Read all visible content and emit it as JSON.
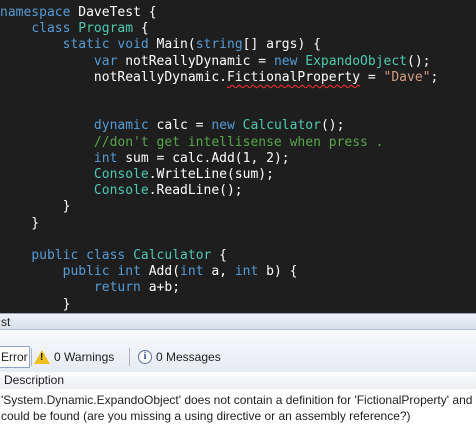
{
  "editor": {
    "lines": [
      {
        "segments": [
          {
            "t": "namespace",
            "c": "kw"
          },
          {
            "t": " DaveTest {",
            "c": ""
          }
        ]
      },
      {
        "segments": [
          {
            "t": "    ",
            "c": ""
          },
          {
            "t": "class",
            "c": "kw"
          },
          {
            "t": " ",
            "c": ""
          },
          {
            "t": "Program",
            "c": "ty"
          },
          {
            "t": " {",
            "c": ""
          }
        ]
      },
      {
        "segments": [
          {
            "t": "        ",
            "c": ""
          },
          {
            "t": "static",
            "c": "kw"
          },
          {
            "t": " ",
            "c": ""
          },
          {
            "t": "void",
            "c": "kw"
          },
          {
            "t": " Main(",
            "c": ""
          },
          {
            "t": "string",
            "c": "kw"
          },
          {
            "t": "[] args) {",
            "c": ""
          }
        ]
      },
      {
        "segments": [
          {
            "t": "            ",
            "c": ""
          },
          {
            "t": "var",
            "c": "kw"
          },
          {
            "t": " notReallyDynamic = ",
            "c": ""
          },
          {
            "t": "new",
            "c": "kw"
          },
          {
            "t": " ",
            "c": ""
          },
          {
            "t": "ExpandoObject",
            "c": "ty"
          },
          {
            "t": "();",
            "c": ""
          }
        ]
      },
      {
        "segments": [
          {
            "t": "            notReallyDynamic.",
            "c": ""
          },
          {
            "t": "FictionalProperty",
            "c": "squiggle"
          },
          {
            "t": " = ",
            "c": ""
          },
          {
            "t": "\"Dave\"",
            "c": "st"
          },
          {
            "t": ";",
            "c": ""
          }
        ]
      },
      {
        "segments": []
      },
      {
        "segments": []
      },
      {
        "segments": [
          {
            "t": "            ",
            "c": ""
          },
          {
            "t": "dynamic",
            "c": "kw"
          },
          {
            "t": " calc = ",
            "c": ""
          },
          {
            "t": "new",
            "c": "kw"
          },
          {
            "t": " ",
            "c": ""
          },
          {
            "t": "Calculator",
            "c": "ty"
          },
          {
            "t": "();",
            "c": ""
          }
        ]
      },
      {
        "segments": [
          {
            "t": "            ",
            "c": ""
          },
          {
            "t": "//don't get intellisense when press .",
            "c": "cm"
          }
        ]
      },
      {
        "segments": [
          {
            "t": "            ",
            "c": ""
          },
          {
            "t": "int",
            "c": "kw"
          },
          {
            "t": " sum = calc.Add(1, 2);",
            "c": ""
          }
        ]
      },
      {
        "segments": [
          {
            "t": "            ",
            "c": ""
          },
          {
            "t": "Console",
            "c": "ty"
          },
          {
            "t": ".WriteLine(sum);",
            "c": ""
          }
        ]
      },
      {
        "segments": [
          {
            "t": "            ",
            "c": ""
          },
          {
            "t": "Console",
            "c": "ty"
          },
          {
            "t": ".ReadLine();",
            "c": ""
          }
        ]
      },
      {
        "segments": [
          {
            "t": "        }",
            "c": ""
          }
        ]
      },
      {
        "segments": [
          {
            "t": "    }",
            "c": ""
          }
        ]
      },
      {
        "segments": []
      },
      {
        "segments": [
          {
            "t": "    ",
            "c": ""
          },
          {
            "t": "public",
            "c": "kw"
          },
          {
            "t": " ",
            "c": ""
          },
          {
            "t": "class",
            "c": "kw"
          },
          {
            "t": " ",
            "c": ""
          },
          {
            "t": "Calculator",
            "c": "ty"
          },
          {
            "t": " {",
            "c": ""
          }
        ]
      },
      {
        "segments": [
          {
            "t": "        ",
            "c": ""
          },
          {
            "t": "public",
            "c": "kw"
          },
          {
            "t": " ",
            "c": ""
          },
          {
            "t": "int",
            "c": "kw"
          },
          {
            "t": " Add(",
            "c": ""
          },
          {
            "t": "int",
            "c": "kw"
          },
          {
            "t": " a, ",
            "c": ""
          },
          {
            "t": "int",
            "c": "kw"
          },
          {
            "t": " b) {",
            "c": ""
          }
        ]
      },
      {
        "segments": [
          {
            "t": "            ",
            "c": ""
          },
          {
            "t": "return",
            "c": "kw"
          },
          {
            "t": " a+b;",
            "c": ""
          }
        ]
      },
      {
        "segments": [
          {
            "t": "        }",
            "c": ""
          }
        ]
      }
    ]
  },
  "panel": {
    "title": "st",
    "toolbar": {
      "errors_label": "Error",
      "warnings_label": "0 Warnings",
      "messages_label": "0 Messages"
    },
    "column_header": "Description",
    "error_line1": "'System.Dynamic.ExpandoObject' does not contain a definition for 'FictionalProperty' and",
    "error_line2": "could be found (are you missing a using directive or an assembly reference?)"
  },
  "colors": {
    "editor_bg": "#1e1e1e",
    "keyword": "#569cd6",
    "type": "#4ec9b0",
    "string": "#d69d85",
    "comment": "#57a64a",
    "error_squiggle": "#ff3030"
  }
}
